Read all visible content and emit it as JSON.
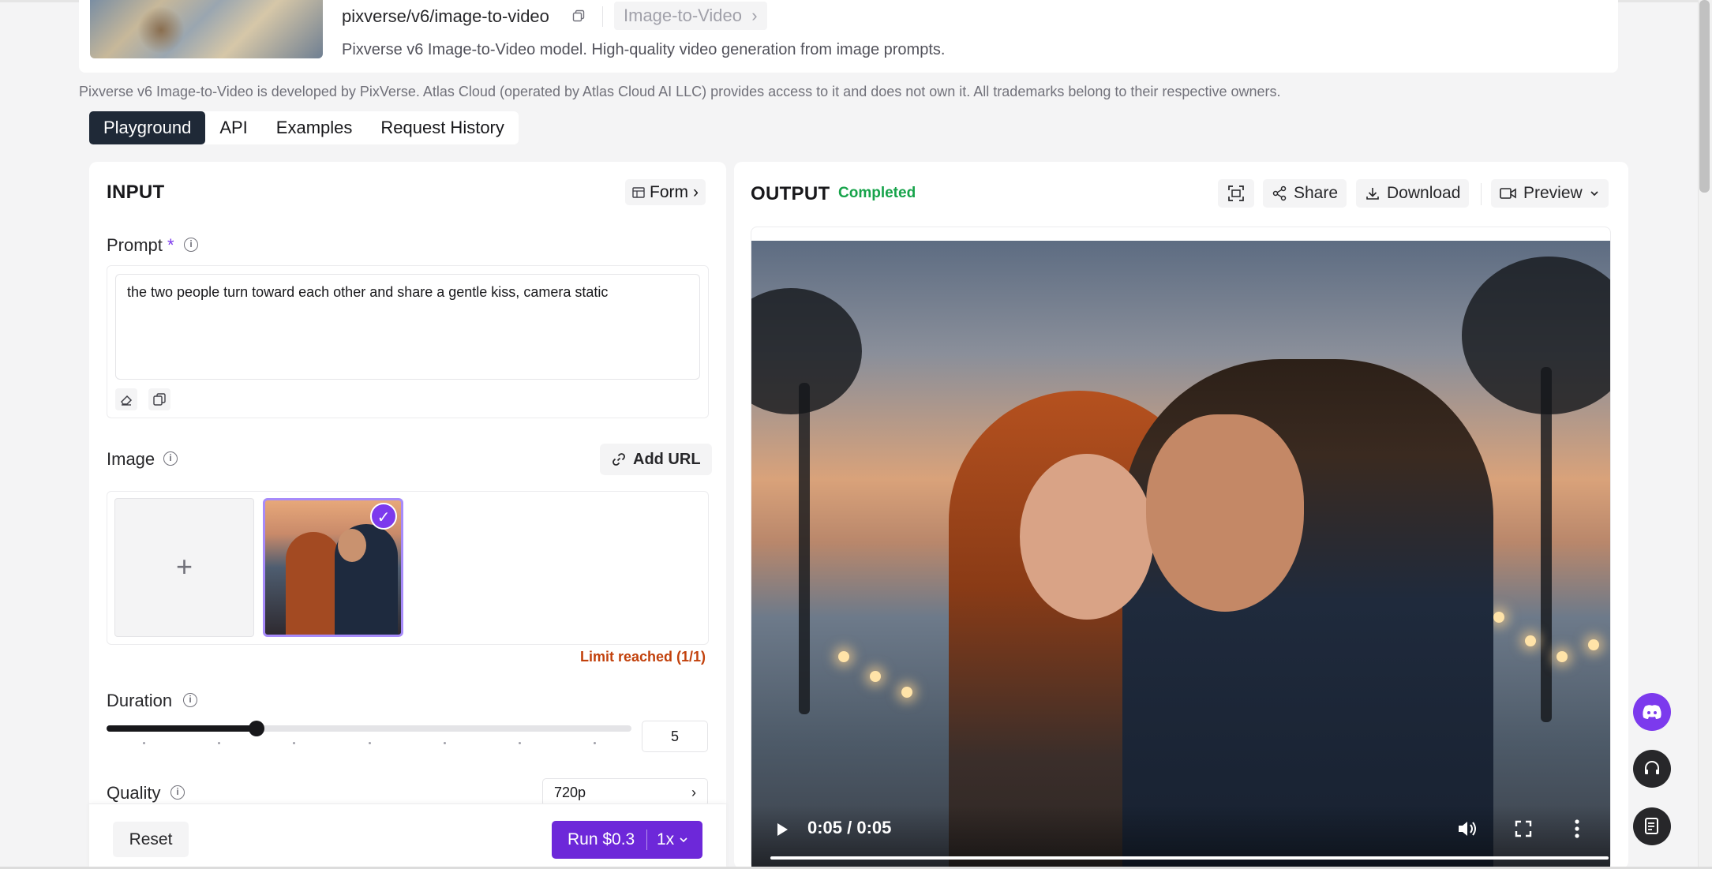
{
  "header": {
    "model_path": "pixverse/v6/image-to-video",
    "category": "Image-to-Video",
    "description": "Pixverse v6 Image-to-Video model. High-quality video generation from image prompts.",
    "disclaimer": "Pixverse v6 Image-to-Video is developed by PixVerse. Atlas Cloud (operated by Atlas Cloud AI LLC) provides access to it and does not own it. All trademarks belong to their respective owners."
  },
  "tabs": [
    {
      "label": "Playground",
      "active": true
    },
    {
      "label": "API"
    },
    {
      "label": "Examples"
    },
    {
      "label": "Request History"
    }
  ],
  "input": {
    "title": "INPUT",
    "form_button": "Form",
    "prompt": {
      "label": "Prompt",
      "required_mark": "*",
      "value": "the two people turn toward each other and share a gentle kiss, camera static"
    },
    "image": {
      "label": "Image",
      "add_url_button": "Add URL",
      "upload_symbol": "+",
      "limit_text": "Limit reached (1/1)"
    },
    "duration": {
      "label": "Duration",
      "value": "5",
      "slider_fraction": 0.29
    },
    "quality": {
      "label": "Quality",
      "value": "720p"
    },
    "reset_button": "Reset",
    "run_button": "Run $0.3",
    "multiplier": "1x"
  },
  "output": {
    "title": "OUTPUT",
    "status": "Completed",
    "status_color": "#16a34a",
    "share_button": "Share",
    "download_button": "Download",
    "preview_button": "Preview",
    "video_time": "0:05 / 0:05"
  },
  "colors": {
    "accent": "#6d28d9",
    "discord": "#7c3aed",
    "limit": "#c2410c"
  }
}
